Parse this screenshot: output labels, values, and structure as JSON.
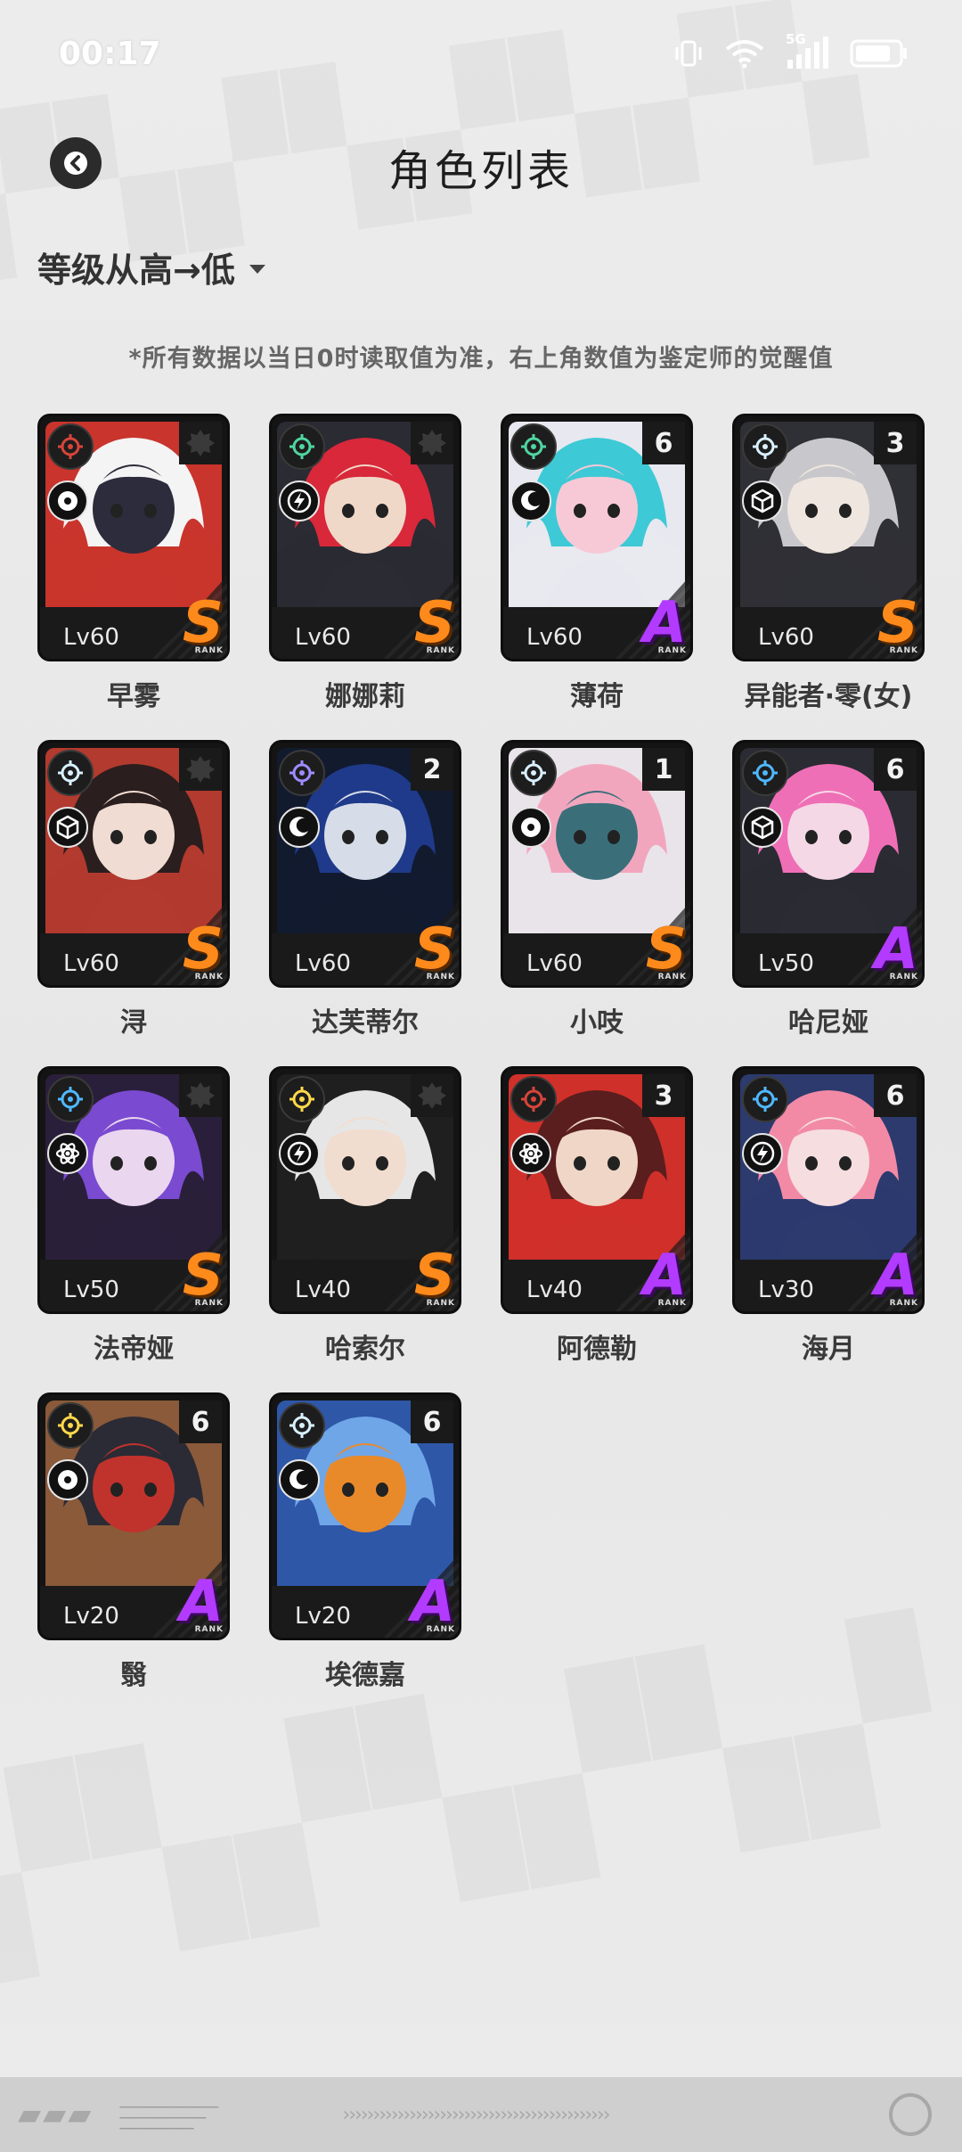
{
  "status_bar": {
    "time": "00:17",
    "network": "5G"
  },
  "header": {
    "title": "角色列表"
  },
  "sort": {
    "label": "等级从高→低"
  },
  "notice": "*所有数据以当日0时读取值为准，右上角数值为鉴定师的觉醒值",
  "rank_sublabel": "RANK",
  "characters": [
    {
      "name": "早雾",
      "level": "Lv60",
      "rank": "S",
      "awaken": "",
      "element": "red",
      "type": "vortex",
      "palette": [
        "#f4f4f4",
        "#c9342c",
        "#2c2c3c"
      ]
    },
    {
      "name": "娜娜莉",
      "level": "Lv60",
      "rank": "S",
      "awaken": "",
      "element": "green",
      "type": "bolt",
      "palette": [
        "#d8283a",
        "#2b2b33",
        "#f0d8c8"
      ]
    },
    {
      "name": "薄荷",
      "level": "Lv60",
      "rank": "A",
      "awaken": "6",
      "element": "green",
      "type": "moon",
      "palette": [
        "#3ec9d6",
        "#e8e8f0",
        "#f7c9d6"
      ]
    },
    {
      "name": "异能者·零(女)",
      "level": "Lv60",
      "rank": "S",
      "awaken": "3",
      "element": "white",
      "type": "cube",
      "palette": [
        "#c8c8cc",
        "#2f2f36",
        "#efe6df"
      ]
    },
    {
      "name": "浔",
      "level": "Lv60",
      "rank": "S",
      "awaken": "",
      "element": "white",
      "type": "cube",
      "palette": [
        "#2a1e1e",
        "#b23a2e",
        "#f0dcd2"
      ]
    },
    {
      "name": "达芙蒂尔",
      "level": "Lv60",
      "rank": "S",
      "awaken": "2",
      "element": "purple",
      "type": "moon",
      "palette": [
        "#1f3a8a",
        "#121a2e",
        "#d7dde8"
      ]
    },
    {
      "name": "小吱",
      "level": "Lv60",
      "rank": "S",
      "awaken": "1",
      "element": "white",
      "type": "vortex",
      "palette": [
        "#f2a6bd",
        "#e9e3ea",
        "#3a6f7a"
      ]
    },
    {
      "name": "哈尼娅",
      "level": "Lv50",
      "rank": "A",
      "awaken": "6",
      "element": "blue",
      "type": "cube",
      "palette": [
        "#ef6fb6",
        "#2b2b33",
        "#f5d8e6"
      ]
    },
    {
      "name": "法帝娅",
      "level": "Lv50",
      "rank": "S",
      "awaken": "",
      "element": "blue",
      "type": "atom",
      "palette": [
        "#7a4ad1",
        "#2a1f3a",
        "#ead6ee"
      ]
    },
    {
      "name": "哈索尔",
      "level": "Lv40",
      "rank": "S",
      "awaken": "",
      "element": "yellow",
      "type": "bolt",
      "palette": [
        "#e6e6e6",
        "#1f1f1f",
        "#f1ddcf"
      ]
    },
    {
      "name": "阿德勒",
      "level": "Lv40",
      "rank": "A",
      "awaken": "3",
      "element": "red",
      "type": "atom",
      "palette": [
        "#5a1e1e",
        "#d0302a",
        "#f0d6c6"
      ]
    },
    {
      "name": "海月",
      "level": "Lv30",
      "rank": "A",
      "awaken": "6",
      "element": "blue",
      "type": "bolt",
      "palette": [
        "#f28aa6",
        "#2c3a6e",
        "#f6dde0"
      ]
    },
    {
      "name": "翳",
      "level": "Lv20",
      "rank": "A",
      "awaken": "6",
      "element": "yellow",
      "type": "vortex",
      "palette": [
        "#2b2b35",
        "#8a5a3a",
        "#c0332c"
      ]
    },
    {
      "name": "埃德嘉",
      "level": "Lv20",
      "rank": "A",
      "awaken": "6",
      "element": "white",
      "type": "moon",
      "palette": [
        "#6fa6e8",
        "#2e57a8",
        "#e98a2a"
      ]
    }
  ],
  "colors": {
    "rank_S": "#ff8a1c",
    "rank_A": "#b23bff",
    "element_red": "#d8443a",
    "element_green": "#4fd6a0",
    "element_white": "#d9f0ff",
    "element_purple": "#9e8cff",
    "element_blue": "#4fb8ff",
    "element_yellow": "#ffd84a"
  }
}
